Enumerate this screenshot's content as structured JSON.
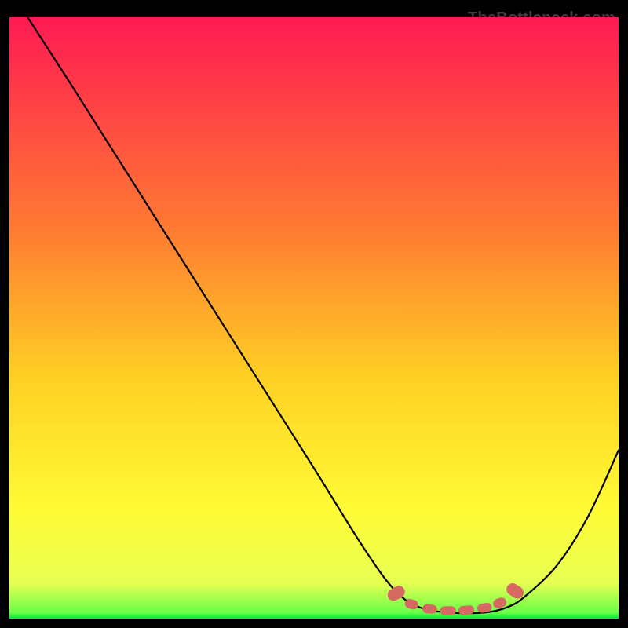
{
  "watermark": "TheBottleneck.com",
  "chart_data": {
    "type": "line",
    "title": "",
    "xlabel": "",
    "ylabel": "",
    "xlim": [
      0,
      100
    ],
    "ylim": [
      0,
      100
    ],
    "grid": false,
    "legend": false,
    "gradient_stops": [
      {
        "offset": 0,
        "color": "#ff1a53"
      },
      {
        "offset": 35,
        "color": "#ff7a32"
      },
      {
        "offset": 60,
        "color": "#ffd024"
      },
      {
        "offset": 82,
        "color": "#fffb35"
      },
      {
        "offset": 94,
        "color": "#e8ff52"
      },
      {
        "offset": 99,
        "color": "#6aff48"
      },
      {
        "offset": 100,
        "color": "#00e83a"
      }
    ],
    "series": [
      {
        "name": "curve",
        "color": "#000000",
        "width": 2.2,
        "x": [
          3,
          10,
          20,
          30,
          40,
          50,
          58,
          63,
          67,
          72,
          78,
          82,
          85,
          90,
          95,
          100
        ],
        "y": [
          100,
          89,
          73,
          57,
          41,
          25,
          12,
          5,
          2,
          1,
          1,
          2,
          4,
          9,
          17,
          28
        ]
      }
    ],
    "markers": {
      "name": "bottom-cluster",
      "shape": "capsule",
      "color": "#d66a63",
      "points": [
        {
          "x": 63.5,
          "y": 4.2,
          "w": 2.0,
          "h": 3.0,
          "rot": 60
        },
        {
          "x": 66.0,
          "y": 2.4,
          "w": 2.2,
          "h": 1.6,
          "rot": 15
        },
        {
          "x": 69.0,
          "y": 1.6,
          "w": 2.4,
          "h": 1.5,
          "rot": 5
        },
        {
          "x": 72.0,
          "y": 1.3,
          "w": 2.6,
          "h": 1.5,
          "rot": 0
        },
        {
          "x": 75.0,
          "y": 1.4,
          "w": 2.6,
          "h": 1.5,
          "rot": -5
        },
        {
          "x": 78.0,
          "y": 1.8,
          "w": 2.4,
          "h": 1.5,
          "rot": -10
        },
        {
          "x": 80.5,
          "y": 2.6,
          "w": 2.2,
          "h": 1.6,
          "rot": -18
        },
        {
          "x": 83.0,
          "y": 4.6,
          "w": 2.0,
          "h": 3.0,
          "rot": -58
        }
      ]
    }
  }
}
